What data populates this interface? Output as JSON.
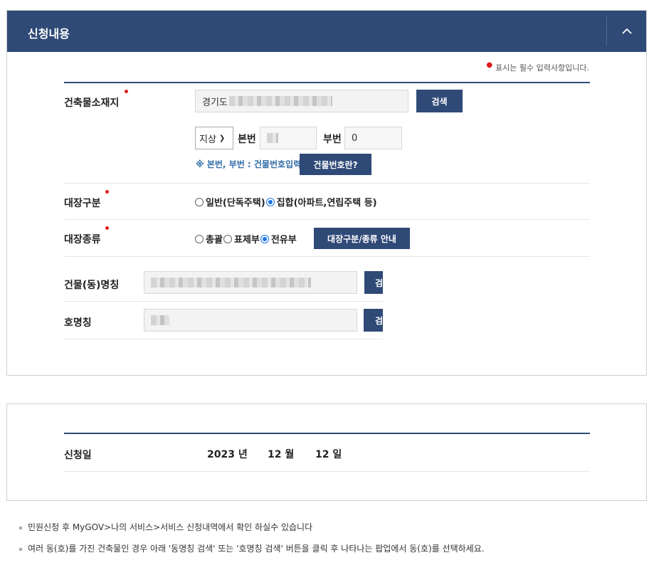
{
  "section": {
    "title": "신청내용",
    "required_note": "표시는 필수 입력사항입니다."
  },
  "building_location": {
    "label": "건축물소재지",
    "address_prefix": "경기도",
    "search_button": "검색",
    "land_type": "지상",
    "main_number_label": "본번",
    "sub_number_label": "부번",
    "sub_number_value": "0",
    "hint": "※ 본번, 부번 : 건물번호입력",
    "building_number_button": "건물번호란?"
  },
  "ledger_category": {
    "label": "대장구분",
    "options": [
      {
        "label": "일반(단독주택)",
        "selected": false
      },
      {
        "label": "집합(아파트,연립주택 등)",
        "selected": true
      }
    ]
  },
  "ledger_type": {
    "label": "대장종류",
    "options": [
      {
        "label": "총괄",
        "selected": false
      },
      {
        "label": "표제부",
        "selected": false
      },
      {
        "label": "전유부",
        "selected": true
      }
    ],
    "guide_button": "대장구분/종류 안내"
  },
  "building_name": {
    "label": "건물(동)명칭",
    "search_button": "검"
  },
  "unit_name": {
    "label": "호명칭",
    "search_button": "검"
  },
  "application_date": {
    "label": "신청일",
    "year": "2023",
    "year_unit": "년",
    "month": "12",
    "month_unit": "월",
    "day": "12",
    "day_unit": "일"
  },
  "notes": [
    "민원신청 후 MyGOV>나의 서비스>서비스 신청내역에서 확인 하실수 있습니다",
    "여러 동(호)를 가진 건축물인 경우 아래 '동명칭 검색' 또는 '호명칭 검색' 버튼을 클릭 후 나타나는 팝업에서 동(호)를 선택하세요."
  ]
}
